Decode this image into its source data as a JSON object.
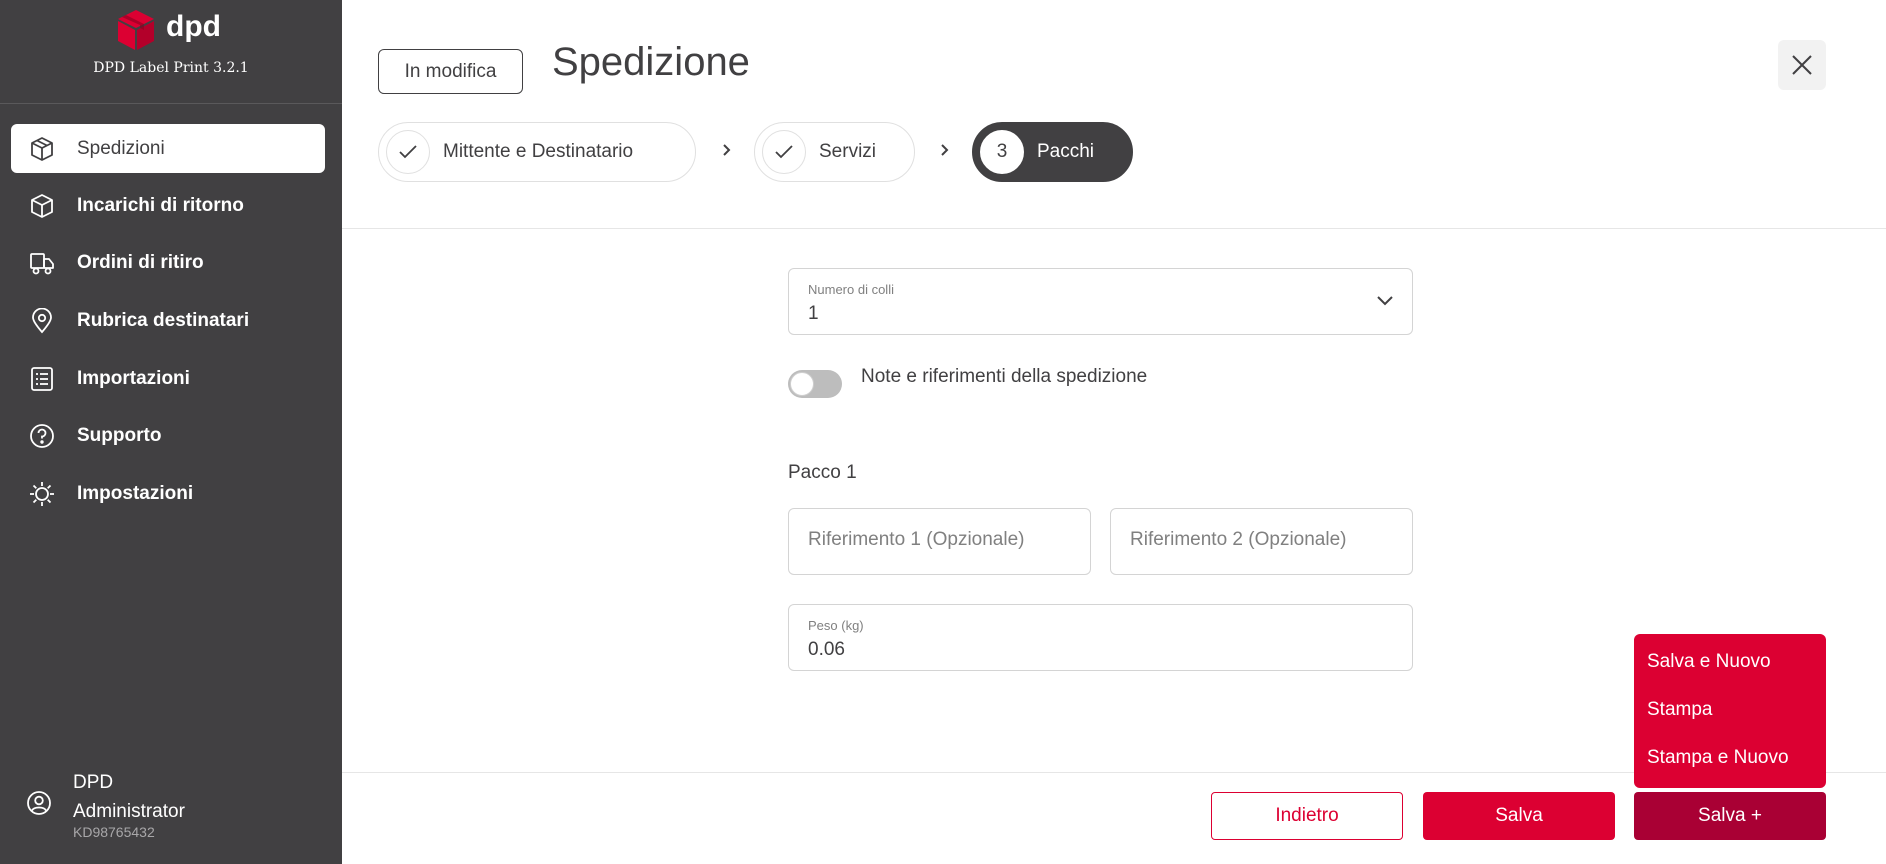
{
  "sidebar": {
    "brand_name": "dpd",
    "version": "DPD Label Print 3.2.1",
    "items": [
      {
        "label": "Spedizioni",
        "icon": "box-icon"
      },
      {
        "label": "Incarichi di ritorno",
        "icon": "box-return-icon"
      },
      {
        "label": "Ordini di ritiro",
        "icon": "truck-icon"
      },
      {
        "label": "Rubrica destinatari",
        "icon": "location-pin-icon"
      },
      {
        "label": "Importazioni",
        "icon": "list-icon"
      },
      {
        "label": "Supporto",
        "icon": "help-icon"
      },
      {
        "label": "Impostazioni",
        "icon": "gear-icon"
      }
    ],
    "active_index": 0,
    "user": {
      "first": "DPD",
      "last": "Administrator",
      "id": "KD98765432"
    }
  },
  "header": {
    "status_badge": "In modifica",
    "title": "Spedizione",
    "steps": [
      {
        "label": "Mittente e Destinatario",
        "state": "done"
      },
      {
        "label": "Servizi",
        "state": "done"
      },
      {
        "number": "3",
        "label": "Pacchi",
        "state": "active"
      }
    ]
  },
  "form": {
    "colli": {
      "label": "Numero di colli",
      "value": "1"
    },
    "notes_toggle": {
      "label": "Note e riferimenti della spedizione",
      "on": false
    },
    "package_title": "Pacco 1",
    "ref1_placeholder": "Riferimento 1 (Opzionale)",
    "ref2_placeholder": "Riferimento 2 (Opzionale)",
    "weight": {
      "label": "Peso (kg)",
      "value": "0.06"
    }
  },
  "footer": {
    "back_label": "Indietro",
    "save_label": "Salva",
    "save_plus_label": "Salva +",
    "menu": [
      "Salva e Nuovo",
      "Stampa",
      "Stampa e Nuovo"
    ]
  },
  "colors": {
    "brand_red": "#dc0032",
    "sidebar": "#414042",
    "dark_red": "#a90034"
  }
}
